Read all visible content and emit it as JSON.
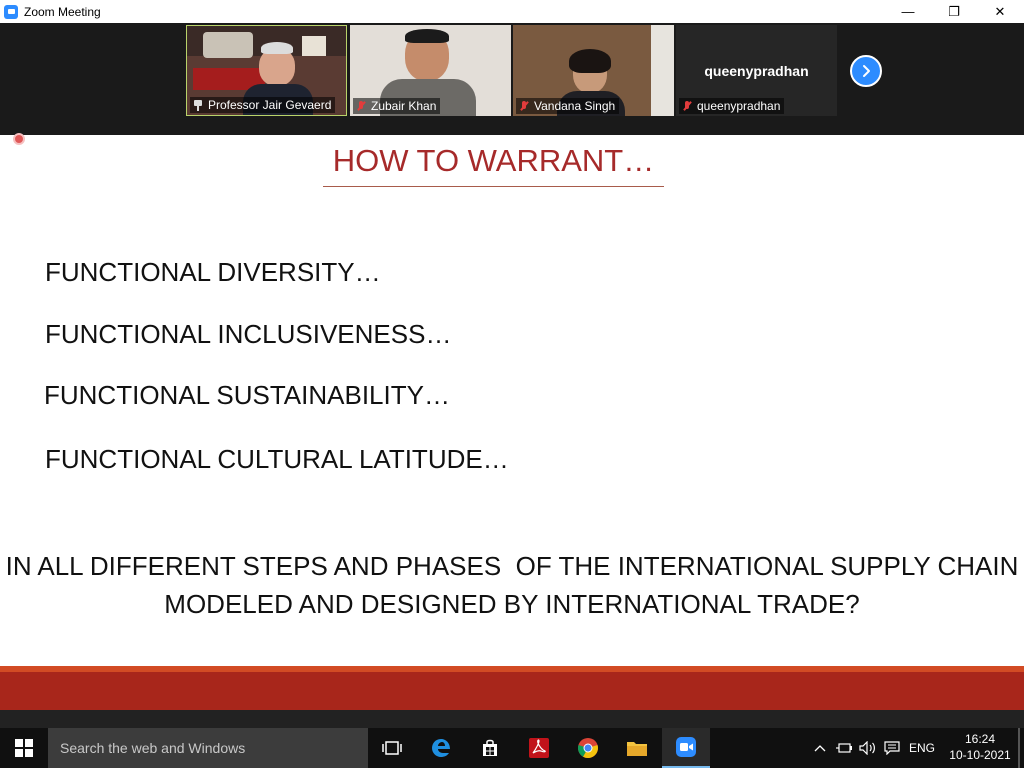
{
  "window": {
    "title": "Zoom Meeting",
    "minimize_glyph": "—",
    "maximize_glyph": "❐",
    "close_glyph": "✕"
  },
  "participants": [
    {
      "name": "Professor Jair Gevaerd",
      "status_icon": "pin-icon",
      "active_speaker": true
    },
    {
      "name": "Zubair Khan",
      "status_icon": "mic-muted-icon"
    },
    {
      "name": "Vandana Singh",
      "status_icon": "mic-muted-icon"
    },
    {
      "name": "queenypradhan",
      "status_icon": "mic-muted-icon",
      "display_name": "queenypradhan",
      "video_off": true
    }
  ],
  "slide": {
    "title": "HOW TO WARRANT…",
    "bullets": [
      "FUNCTIONAL DIVERSITY…",
      "FUNCTIONAL INCLUSIVENESS…",
      "FUNCTIONAL SUSTAINABILITY…",
      "FUNCTIONAL CULTURAL LATITUDE…"
    ],
    "question_line1": "IN ALL DIFFERENT STEPS AND PHASES  OF THE INTERNATIONAL SUPPLY CHAIN",
    "question_line2": "MODELED AND DESIGNED BY INTERNATIONAL TRADE?",
    "title_color": "#a62a2a",
    "footer_color": "#a8261b"
  },
  "taskbar": {
    "search_placeholder": "Search the web and Windows",
    "language": "ENG",
    "time": "16:24",
    "date": "10-10-2021"
  }
}
